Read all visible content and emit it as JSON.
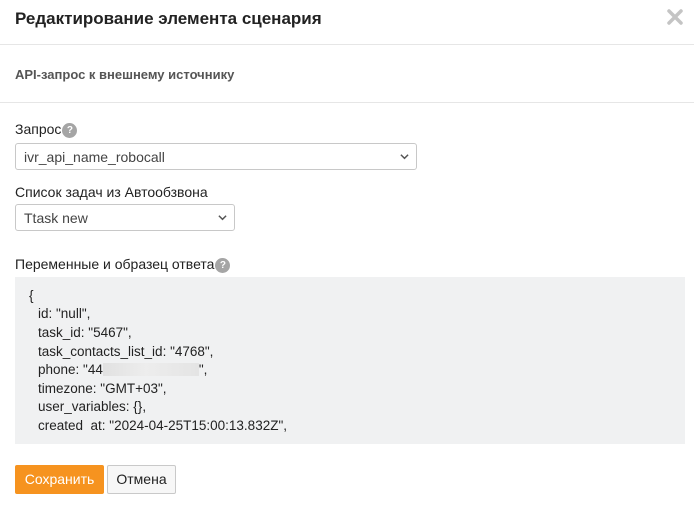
{
  "dialog": {
    "title": "Редактирование элемента сценария",
    "close_icon": "close-icon",
    "subtitle": "API-запрос к внешнему источнику"
  },
  "form": {
    "request": {
      "label": "Запрос",
      "help_glyph": "?",
      "value": "ivr_api_name_robocall"
    },
    "tasks": {
      "label": "Список задач из Автообзвона",
      "value": "Ttask new"
    },
    "variables": {
      "label": "Переменные и образец ответа",
      "help_glyph": "?",
      "code": {
        "open_brace": "{",
        "id": "id: \"null\",",
        "task_id": "task_id: \"5467\",",
        "task_contacts_list_id": "task_contacts_list_id: \"4768\",",
        "phone_prefix": "phone: \"44",
        "phone_suffix": "\",",
        "timezone": "timezone: \"GMT+03\",",
        "user_variables": "user_variables: {},",
        "created_at": "created  at: \"2024-04-25T15:00:13.832Z\","
      }
    }
  },
  "buttons": {
    "save": "Сохранить",
    "cancel": "Отмена"
  },
  "colors": {
    "accent": "#f6931f",
    "code_bg": "#f0f1f2",
    "help_bg": "#a5a5a5"
  }
}
